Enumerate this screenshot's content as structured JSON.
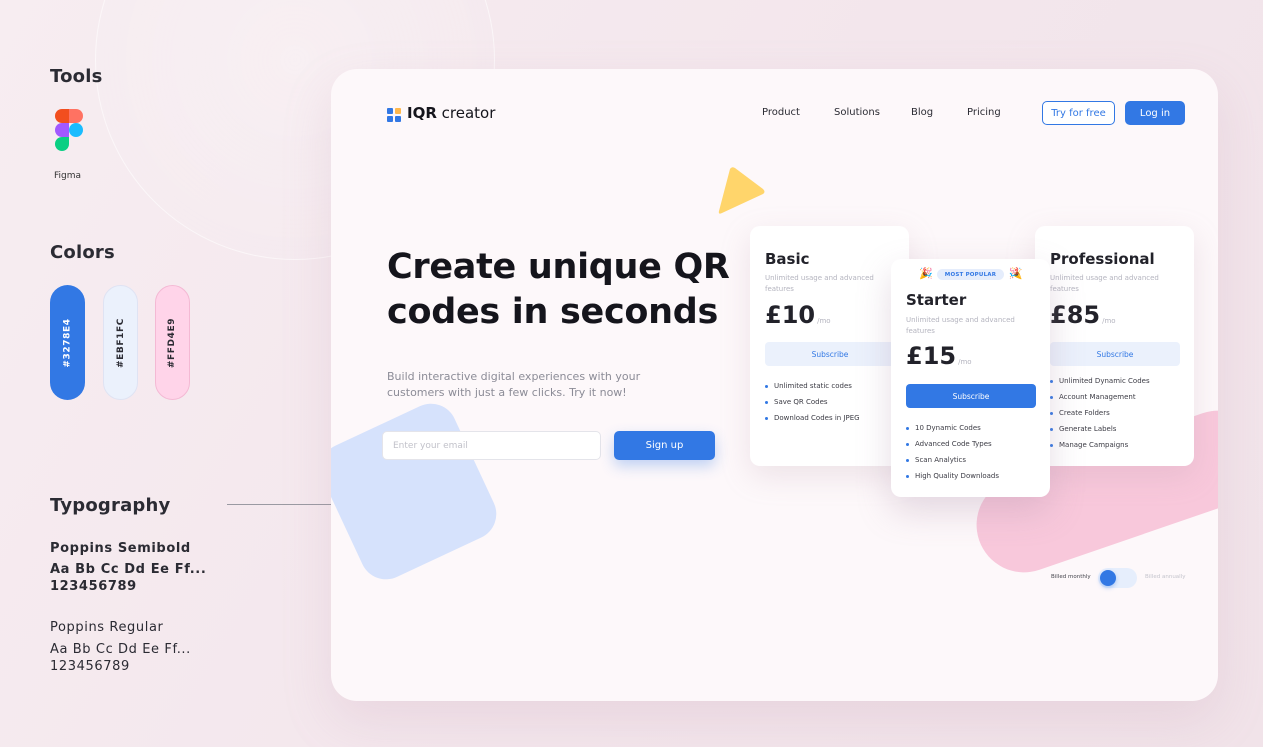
{
  "styleguide": {
    "tools_heading": "Tools",
    "tool_name": "Figma",
    "colors_heading": "Colors",
    "swatches": [
      {
        "hex": "#3278E4",
        "bg": "#3278E4",
        "text": "#ffffff"
      },
      {
        "hex": "#EBF1FC",
        "bg": "#EBF1FC",
        "text": "#2b2b33"
      },
      {
        "hex": "#FFD4E9",
        "bg": "#FFD4E9",
        "text": "#2b2b33"
      }
    ],
    "typography_heading": "Typography",
    "semibold_name": "Poppins Semibold",
    "semibold_sample": "Aa Bb Cc Dd Ee Ff...",
    "semibold_digits": "123456789",
    "regular_name": "Poppins Regular",
    "regular_sample": "Aa Bb Cc Dd Ee Ff...",
    "regular_digits": "123456789"
  },
  "header": {
    "brand_bold": "IQR",
    "brand_light": "creator",
    "nav": [
      "Product",
      "Solutions",
      "Blog",
      "Pricing"
    ],
    "try_free": "Try for free",
    "login": "Log in"
  },
  "hero": {
    "title": "Create unique QR codes in seconds",
    "subtitle": "Build interactive digital experiences with your customers with just a few clicks. Try it now!",
    "email_placeholder": "Enter your email",
    "signup": "Sign up"
  },
  "plans": [
    {
      "name": "Basic",
      "desc": "Unlimited usage and advanced features",
      "price": "£10",
      "per": "/mo",
      "cta": "Subscribe",
      "features": [
        "Unlimited static codes",
        "Save QR Codes",
        "Download Codes in JPEG"
      ]
    },
    {
      "badge": "MOST POPULAR",
      "name": "Starter",
      "desc": "Unlimited usage and advanced features",
      "price": "£15",
      "per": "/mo",
      "cta": "Subscribe",
      "features": [
        "10 Dynamic Codes",
        "Advanced Code Types",
        "Scan Analytics",
        "High Quality Downloads"
      ]
    },
    {
      "name": "Professional",
      "desc": "Unlimited usage and advanced features",
      "price": "£85",
      "per": "/mo",
      "cta": "Subscribe",
      "features": [
        "Unlimited Dynamic Codes",
        "Account Management",
        "Create Folders",
        "Generate Labels",
        "Manage Campaigns"
      ]
    }
  ],
  "billing": {
    "monthly": "Billed monthly",
    "annually": "Billed annually",
    "annual_selected": false
  },
  "colors": {
    "primary": "#3278E4",
    "light_blue": "#EBF1FC",
    "pink": "#FFD4E9",
    "yellow": "#FFD56B"
  },
  "icons": [
    "figma-logo-icon",
    "logo-grid-icon",
    "party-popper-icon",
    "yellow-triangle-shape"
  ]
}
